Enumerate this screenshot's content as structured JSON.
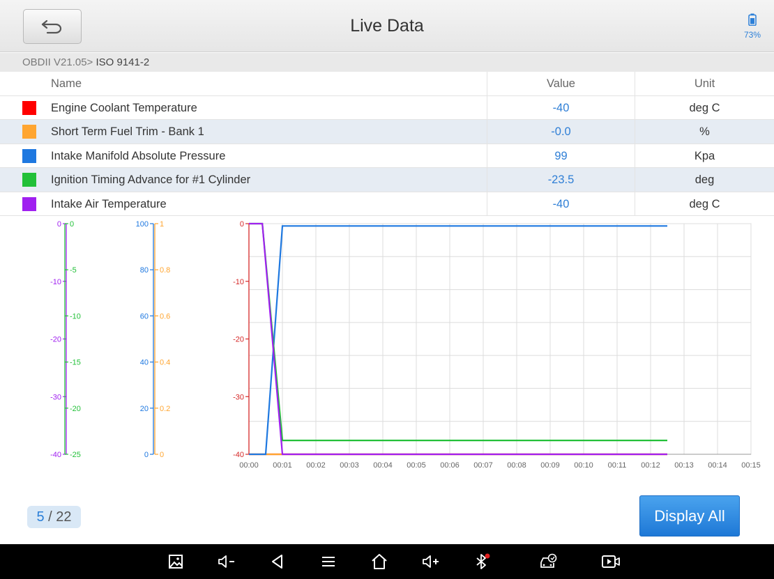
{
  "header": {
    "title": "Live Data",
    "battery_percent": "73%"
  },
  "breadcrumb": {
    "prefix": "OBDII V21.05>",
    "current": " ISO 9141-2"
  },
  "table": {
    "columns": {
      "name": "Name",
      "value": "Value",
      "unit": "Unit"
    },
    "rows": [
      {
        "color": "#ff0000",
        "name": "Engine Coolant Temperature",
        "value": "-40",
        "unit": "deg C"
      },
      {
        "color": "#ffa530",
        "name": "Short Term Fuel Trim - Bank 1",
        "value": "-0.0",
        "unit": "%"
      },
      {
        "color": "#1e78e0",
        "name": "Intake Manifold Absolute Pressure",
        "value": "99",
        "unit": "Kpa"
      },
      {
        "color": "#22c038",
        "name": "Ignition Timing Advance for #1 Cylinder",
        "value": "-23.5",
        "unit": "deg"
      },
      {
        "color": "#a020f0",
        "name": "Intake Air Temperature",
        "value": "-40",
        "unit": "deg C"
      }
    ]
  },
  "chart_data": {
    "type": "line",
    "x_ticks": [
      "00:00",
      "00:01",
      "00:02",
      "00:03",
      "00:04",
      "00:05",
      "00:06",
      "00:07",
      "00:08",
      "00:09",
      "00:10",
      "00:11",
      "00:12",
      "00:13",
      "00:14",
      "00:15"
    ],
    "xlim": [
      0,
      15
    ],
    "axes": [
      {
        "color": "#a020f0",
        "ticks": [
          "0",
          "-10",
          "-20",
          "-30",
          "-40"
        ],
        "ylim": [
          -40,
          0
        ]
      },
      {
        "color": "#22c038",
        "ticks": [
          "0",
          "-5",
          "-10",
          "-15",
          "-20",
          "-25"
        ],
        "ylim": [
          -25,
          0
        ]
      },
      {
        "color": "#1e78e0",
        "ticks": [
          "100",
          "80",
          "60",
          "40",
          "20",
          "0"
        ],
        "ylim": [
          0,
          100
        ]
      },
      {
        "color": "#ffa530",
        "ticks": [
          "1",
          "0.8",
          "0.6",
          "0.4",
          "0.2",
          "0"
        ],
        "ylim": [
          0,
          1
        ]
      },
      {
        "color": "#d62828",
        "ticks": [
          "0",
          "-10",
          "-20",
          "-30",
          "-40"
        ],
        "ylim": [
          -40,
          0
        ]
      }
    ],
    "series": [
      {
        "color": "#ff0000",
        "axis": 4,
        "points": [
          [
            0,
            -40
          ],
          [
            12.5,
            -40
          ]
        ]
      },
      {
        "color": "#ffa530",
        "axis": 3,
        "points": [
          [
            0,
            0
          ],
          [
            12.5,
            0
          ]
        ]
      },
      {
        "color": "#1e78e0",
        "axis": 2,
        "points": [
          [
            0,
            0
          ],
          [
            0.5,
            0
          ],
          [
            1,
            99
          ],
          [
            12.5,
            99
          ]
        ]
      },
      {
        "color": "#22c038",
        "axis": 1,
        "points": [
          [
            0,
            0
          ],
          [
            0.4,
            0
          ],
          [
            1,
            -23.5
          ],
          [
            12.5,
            -23.5
          ]
        ]
      },
      {
        "color": "#a020f0",
        "axis": 0,
        "points": [
          [
            0,
            0
          ],
          [
            0.4,
            0
          ],
          [
            1,
            -40
          ],
          [
            12.5,
            -40
          ]
        ]
      }
    ]
  },
  "pager": {
    "current": "5",
    "total": "/ 22"
  },
  "actions": {
    "display_all": "Display All"
  }
}
